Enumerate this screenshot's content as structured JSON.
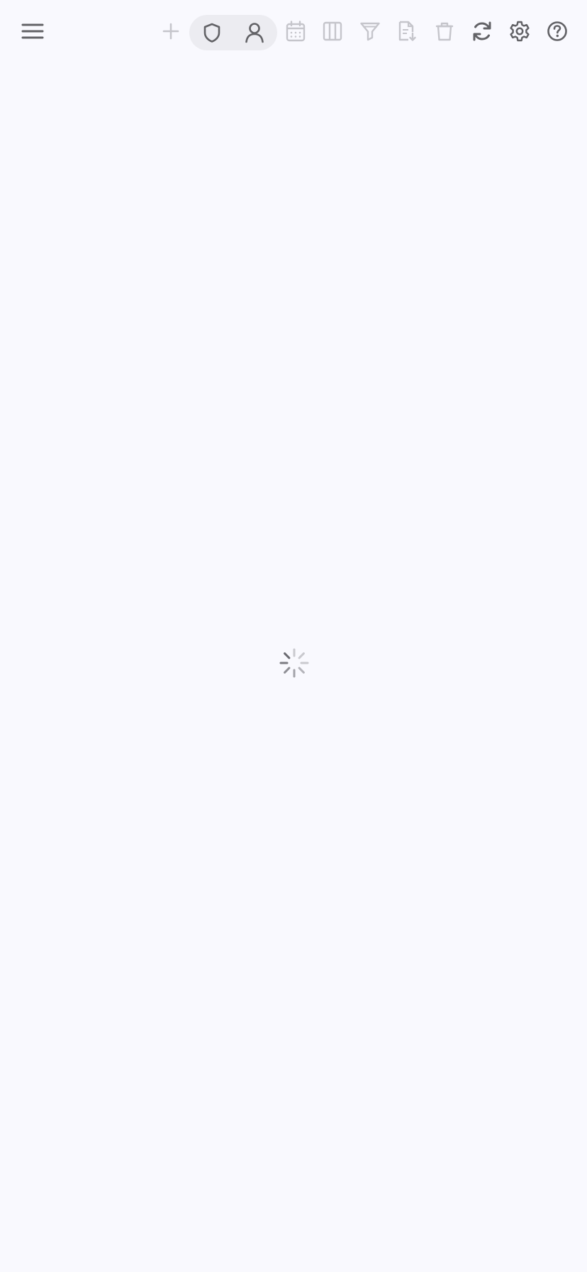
{
  "toolbar": {
    "menu": {
      "icon": "hamburger-menu-icon"
    },
    "add": {
      "icon": "plus-icon",
      "disabled": true
    },
    "segmented_control": {
      "items": [
        {
          "icon": "shield-icon",
          "selected": false
        },
        {
          "icon": "person-icon",
          "selected": false
        }
      ]
    },
    "calendar": {
      "icon": "calendar-icon",
      "disabled": true
    },
    "columns": {
      "icon": "columns-icon",
      "disabled": true
    },
    "filter": {
      "icon": "filter-icon",
      "disabled": true
    },
    "export": {
      "icon": "document-download-icon",
      "disabled": true
    },
    "delete": {
      "icon": "trash-icon",
      "disabled": true
    },
    "refresh": {
      "icon": "refresh-icon",
      "disabled": false
    },
    "settings": {
      "icon": "gear-icon",
      "disabled": false
    },
    "help": {
      "icon": "question-circle-icon",
      "disabled": false
    }
  },
  "main": {
    "loading": true,
    "spinner": {
      "icon": "loading-spinner-icon"
    }
  },
  "colors": {
    "background": "#f9f9fe",
    "icon_active": "#626266",
    "icon_disabled": "#c5c5cb",
    "segment_bg": "#ececf1"
  }
}
